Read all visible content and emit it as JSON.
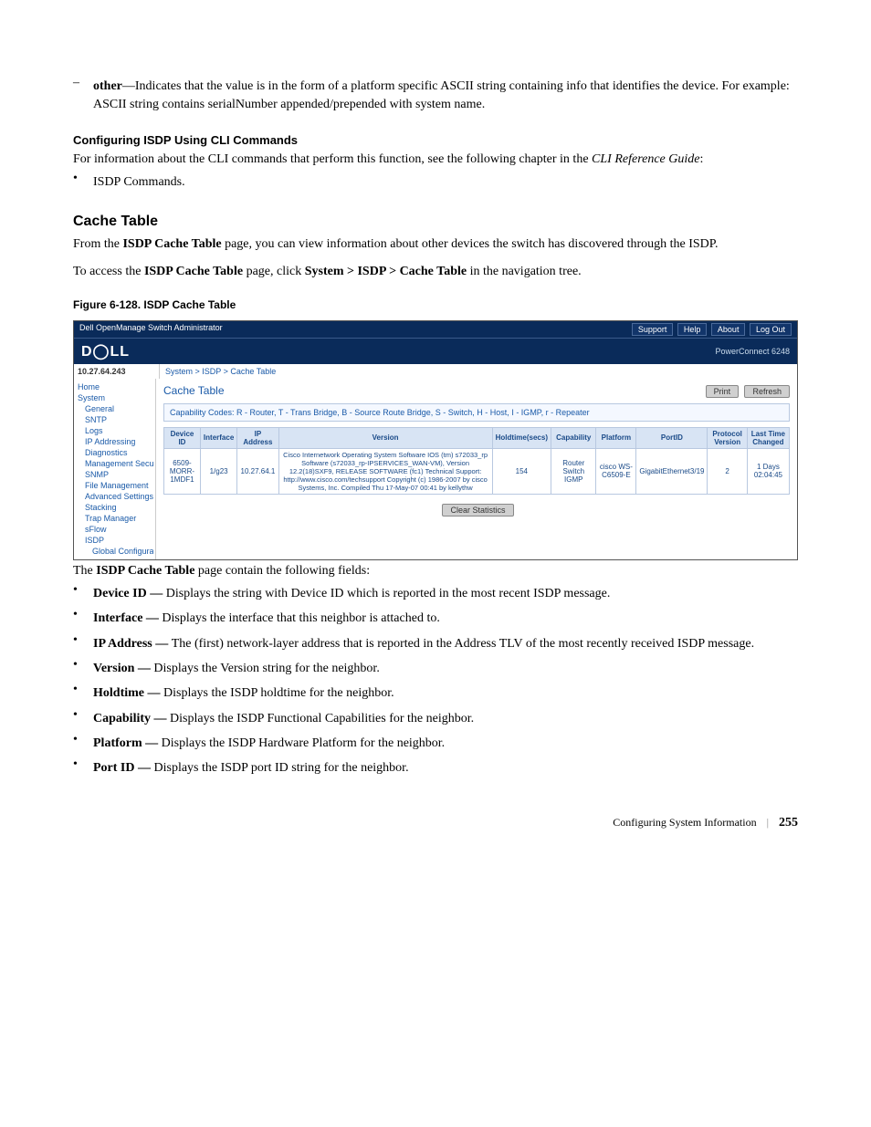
{
  "intro": {
    "dash": "–",
    "other_bold": "other",
    "other_rest": "—Indicates that the value is in the form of a platform specific ASCII string containing info that identifies the device. For example: ASCII string contains serialNumber appended/prepended with system name."
  },
  "cli": {
    "heading": "Configuring ISDP Using CLI Commands",
    "para_a": "For information about the CLI commands that perform this function, see the following chapter in the ",
    "para_b": "CLI Reference Guide",
    "para_c": ":",
    "bullet": "ISDP Commands."
  },
  "cache": {
    "heading": "Cache Table",
    "p1_a": "From the ",
    "p1_b": "ISDP Cache Table",
    "p1_c": " page, you can view information about other devices the switch has discovered through the ISDP.",
    "p2_a": "To access the ",
    "p2_b": "ISDP Cache Table",
    "p2_c": " page, click ",
    "p2_d": "System > ISDP > Cache Table",
    "p2_e": " in the navigation tree."
  },
  "figure": {
    "caption": "Figure 6-128.    ISDP Cache Table"
  },
  "screenshot": {
    "topbar_title": "Dell OpenManage Switch Administrator",
    "topbar_links": {
      "support": "Support",
      "help": "Help",
      "about": "About",
      "logout": "Log Out"
    },
    "logo": "D◯LL",
    "product": "PowerConnect 6248",
    "ip": "10.27.64.243",
    "breadcrumb": "System > ISDP > Cache Table",
    "nav": {
      "home": "Home",
      "system": "System",
      "general": "General",
      "sntp": "SNTP",
      "logs": "Logs",
      "ipaddr": "IP Addressing",
      "diag": "Diagnostics",
      "mgmtsec": "Management Secur",
      "snmp": "SNMP",
      "filemgmt": "File Management",
      "advset": "Advanced Settings",
      "stacking": "Stacking",
      "trap": "Trap Manager",
      "sflow": "sFlow",
      "isdp": "ISDP",
      "globalcfg": "Global Configurat"
    },
    "title": "Cache Table",
    "print": "Print",
    "refresh": "Refresh",
    "capcodes": "Capability Codes: R - Router, T - Trans Bridge, B - Source Route Bridge, S - Switch, H - Host, I - IGMP, r - Repeater",
    "headers": {
      "devid": "Device ID",
      "iface": "Interface",
      "ipaddr": "IP Address",
      "version": "Version",
      "holdtime": "Holdtime(secs)",
      "capability": "Capability",
      "platform": "Platform",
      "portid": "PortID",
      "protoversion": "Protocol Version",
      "lastchanged": "Last Time Changed"
    },
    "row": {
      "devid": "6509-MORR-1MDF1",
      "iface": "1/g23",
      "ipaddr": "10.27.64.1",
      "version": "Cisco Internetwork Operating System Software IOS (tm) s72033_rp Software (s72033_rp-IPSERVICES_WAN-VM), Version 12.2(18)SXF9, RELEASE SOFTWARE (fc1) Technical Support: http://www.cisco.com/techsupport Copyright (c) 1986-2007 by cisco Systems, Inc. Compiled Thu 17-May-07 00:41 by kellythw",
      "holdtime": "154",
      "capability": "Router Switch IGMP",
      "platform": "cisco WS-C6509-E",
      "portid": "GigabitEthernet3/19",
      "protoversion": "2",
      "lastchanged": "1 Days 02:04:45"
    },
    "clear": "Clear Statistics"
  },
  "fields": {
    "intro_a": "The ",
    "intro_b": "ISDP Cache Table",
    "intro_c": " page contain the following fields:",
    "items": {
      "devid_b": "Device ID — ",
      "devid_t": "Displays the string with Device ID which is reported in the most recent ISDP message.",
      "iface_b": "Interface — ",
      "iface_t": "Displays the interface that this neighbor is attached to.",
      "ip_b": "IP Address — ",
      "ip_t": "The (first) network-layer address that is reported in the Address TLV of the most recently received ISDP message.",
      "ver_b": "Version — ",
      "ver_t": "Displays the Version string for the neighbor.",
      "hold_b": "Holdtime — ",
      "hold_t": "Displays the ISDP holdtime for the neighbor.",
      "cap_b": "Capability — ",
      "cap_t": "Displays the ISDP Functional Capabilities for the neighbor.",
      "plat_b": "Platform — ",
      "plat_t": "Displays the ISDP Hardware Platform for the neighbor.",
      "port_b": "Port ID — ",
      "port_t": "Displays the ISDP port ID string for the neighbor."
    }
  },
  "footer": {
    "section": "Configuring System Information",
    "page": "255"
  }
}
